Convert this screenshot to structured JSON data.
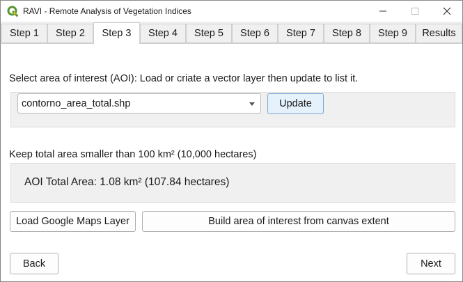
{
  "window": {
    "title": "RAVI - Remote Analysis of Vegetation Indices",
    "icons": {
      "app": "qgis-logo-icon",
      "minimize": "minimize-icon",
      "maximize": "maximize-icon",
      "close": "close-icon"
    }
  },
  "tabs": [
    {
      "label": "Step 1",
      "active": false
    },
    {
      "label": "Step 2",
      "active": false
    },
    {
      "label": "Step 3",
      "active": true
    },
    {
      "label": "Step 4",
      "active": false
    },
    {
      "label": "Step 5",
      "active": false
    },
    {
      "label": "Step 6",
      "active": false
    },
    {
      "label": "Step 7",
      "active": false
    },
    {
      "label": "Step 8",
      "active": false
    },
    {
      "label": "Step 9",
      "active": false
    },
    {
      "label": "Results",
      "active": false
    }
  ],
  "aoi": {
    "instruction": "Select area of interest (AOI):  Load or criate a vector layer then update to list it.",
    "layer_selected": "contorno_area_total.shp",
    "update_label": "Update"
  },
  "area": {
    "limit_text": "Keep total area smaller than 100 km² (10,000 hectares)",
    "total_text": "AOI Total Area: 1.08 km² (107.84 hectares)"
  },
  "actions": {
    "load_google_maps": "Load Google Maps Layer",
    "build_aoi_canvas": "Build area of interest from canvas extent"
  },
  "nav": {
    "back": "Back",
    "next": "Next"
  },
  "colors": {
    "qgis_green": "#589632",
    "qgis_yellow": "#ee7913",
    "focus_blue": "#7aa7d6"
  }
}
